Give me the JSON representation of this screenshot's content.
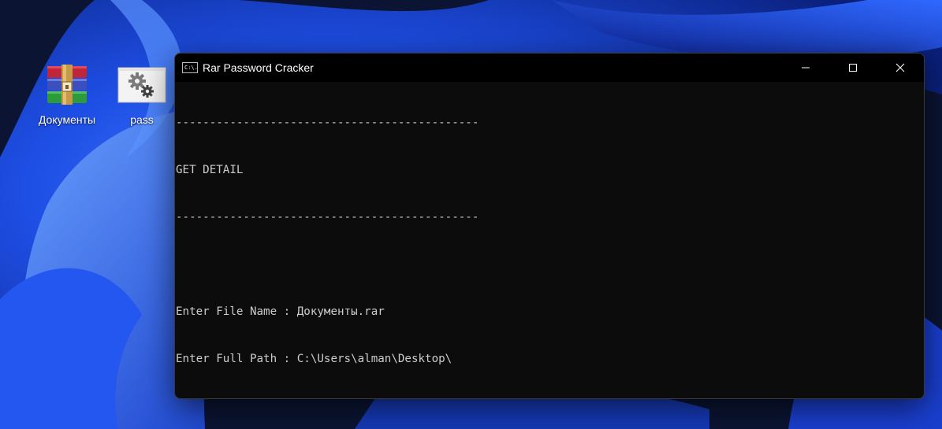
{
  "desktop": {
    "icons": [
      {
        "label": "Документы",
        "icon": "winrar-archive-icon"
      },
      {
        "label": "pass",
        "icon": "settings-file-icon"
      }
    ]
  },
  "window": {
    "title": "Rar Password Cracker",
    "app_icon_text": "C:\\.",
    "controls": {
      "minimize": "minimize-icon",
      "maximize": "maximize-icon",
      "close": "close-icon"
    }
  },
  "terminal": {
    "lines": [
      "---------------------------------------------",
      "GET DETAIL",
      "---------------------------------------------",
      "",
      "Enter File Name : Документы.rar",
      "Enter Full Path : C:\\Users\\alman\\Desktop\\"
    ],
    "text_color": "#cccccc",
    "background": "#0c0c0c"
  },
  "colors": {
    "wallpaper_dark": "#0a1430",
    "wallpaper_blue": "#1f4fe0",
    "wallpaper_light": "#3d7bff"
  }
}
